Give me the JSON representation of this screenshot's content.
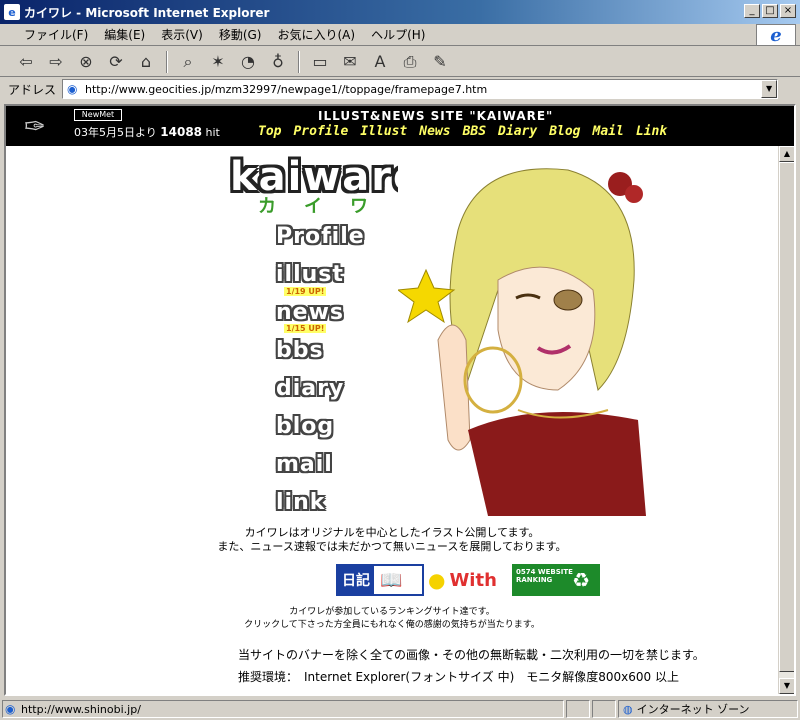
{
  "window": {
    "title": "カイワレ - Microsoft Internet Explorer",
    "minimize": "_",
    "maximize": "□",
    "close": "×"
  },
  "menu": [
    "ファイル(F)",
    "編集(E)",
    "表示(V)",
    "移動(G)",
    "お気に入り(A)",
    "ヘルプ(H)"
  ],
  "address": {
    "label": "アドレス",
    "url": "http://www.geocities.jp/mzm32997/newpage1//toppage/framepage7.htm"
  },
  "banner": {
    "badge": "NewMet",
    "counter_prefix": "03年5月5日より",
    "counter_value": "14088",
    "counter_suffix": "hit",
    "site_title": "ILLUST&NEWS SITE \"KAIWARE\"",
    "nav": [
      "Top",
      "Profile",
      "Illust",
      "News",
      "BBS",
      "Diary",
      "Blog",
      "Mail",
      "Link"
    ]
  },
  "page": {
    "logo": "kaiware",
    "katakana": "カイワレ",
    "links": [
      "Profile",
      "illust",
      "news",
      "bbs",
      "diary",
      "blog",
      "mail",
      "link"
    ],
    "illust_update": "1/19 UP!",
    "news_update": "1/15 UP!",
    "intro_line1": "カイワレはオリジナルを中心としたイラスト公開してます。",
    "intro_line2": "また、ニュース速報では未だかつて無いニュースを展開しております。",
    "banner_nikki": "日記",
    "banner_with": "With",
    "banner_rank": "0574 WEBSITE RANKING",
    "rank_line1": "カイワレが参加しているランキングサイト達です。",
    "rank_line2": "クリックして下さった方全員にもれなく俺の感謝の気持ちが当たります。",
    "copyright": "当サイトのバナーを除く全ての画像・その他の無断転載・二次利用の一切を禁じます。",
    "env": "推奨環境：　Internet Explorer(フォントサイズ 中)　モニタ解像度800x600 以上"
  },
  "status": {
    "url": "http://www.shinobi.jp/",
    "zone": "インターネット ゾーン"
  }
}
